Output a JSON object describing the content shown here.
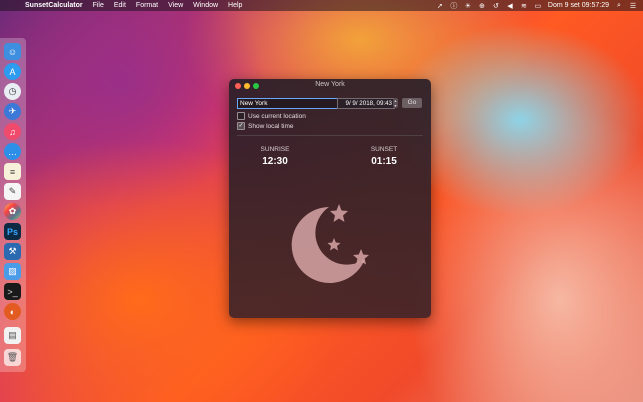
{
  "menubar": {
    "app_name": "SunsetCalculator",
    "menus": [
      "File",
      "Edit",
      "Format",
      "View",
      "Window",
      "Help"
    ],
    "clock": "Dom 9 set  09:57:29"
  },
  "window": {
    "title": "New York",
    "location_value": "New York",
    "date_value": "9/ 9/ 2018, 09:43",
    "go_label": "Go",
    "use_current_location_label": "Use current location",
    "use_current_location_checked": false,
    "show_local_time_label": "Show local time",
    "show_local_time_checked": true,
    "sunrise_label": "SUNRISE",
    "sunrise_time": "12:30",
    "sunset_label": "SUNSET",
    "sunset_time": "01:15"
  },
  "icons": {
    "menubar_right": [
      "location-icon",
      "info-icon",
      "brightness-icon",
      "globe-icon",
      "time-machine-icon",
      "volume-icon",
      "wifi-icon",
      "battery-icon",
      "search-icon",
      "control-center-icon"
    ],
    "dock": [
      "finder-icon",
      "app-store-icon",
      "safari-icon",
      "launchpad-icon",
      "music-icon",
      "messages-icon",
      "notes-icon",
      "textedit-icon",
      "photos-icon",
      "photoshop-icon",
      "xcode-icon",
      "preview-icon",
      "terminal-icon",
      "sunset-app-icon",
      "document-icon",
      "trash-icon"
    ]
  },
  "colors": {
    "focus_ring": "#6aa7ff",
    "moon_fill": "#d7a6a6",
    "traffic_close": "#ff5f57",
    "traffic_min": "#febc2e",
    "traffic_max": "#28c840"
  }
}
